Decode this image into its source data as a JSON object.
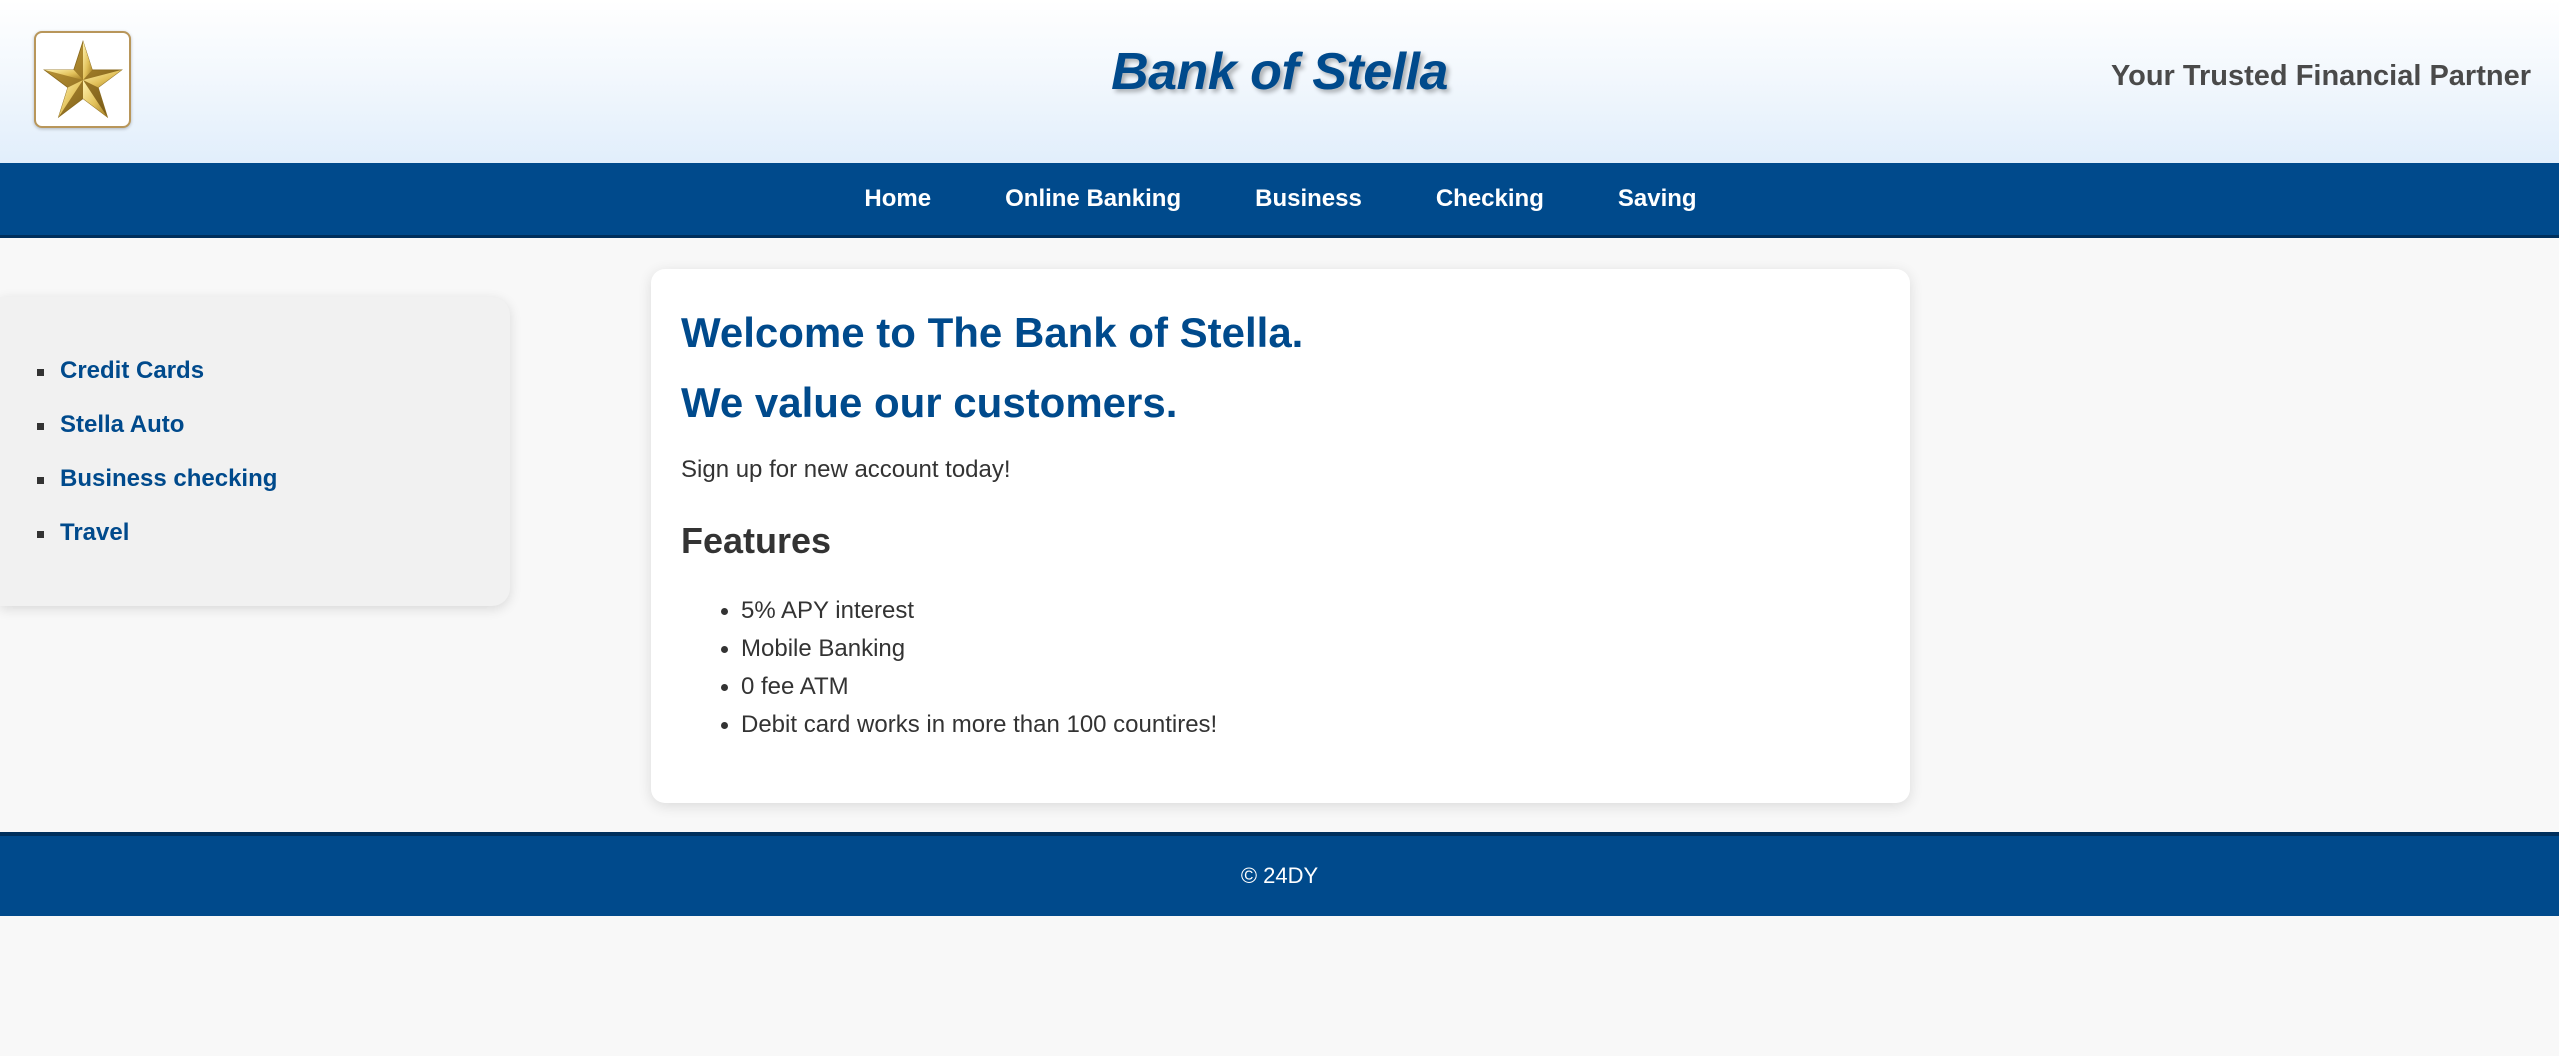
{
  "header": {
    "logo_icon": "gold-star-icon",
    "title": "Bank of Stella",
    "tagline": "Your Trusted Financial Partner"
  },
  "nav": {
    "items": [
      {
        "label": "Home"
      },
      {
        "label": "Online Banking"
      },
      {
        "label": "Business"
      },
      {
        "label": "Checking"
      },
      {
        "label": "Saving"
      }
    ]
  },
  "sidebar": {
    "items": [
      {
        "label": "Credit Cards"
      },
      {
        "label": "Stella Auto"
      },
      {
        "label": "Business checking"
      },
      {
        "label": "Travel"
      }
    ]
  },
  "main": {
    "heading_line1": "Welcome to The Bank of Stella.",
    "heading_line2": "We value our customers.",
    "intro": "Sign up for new account today!",
    "features_title": "Features",
    "features": [
      "5% APY interest",
      "Mobile Banking",
      "0 fee ATM",
      "Debit card works in more than 100 countires!"
    ]
  },
  "footer": {
    "copyright": "© 24DY"
  },
  "colors": {
    "brand_blue": "#004a8c",
    "brand_blue_dark": "#002f5c",
    "page_background": "#f8f8f8",
    "star_gold": "#d4b04a"
  }
}
